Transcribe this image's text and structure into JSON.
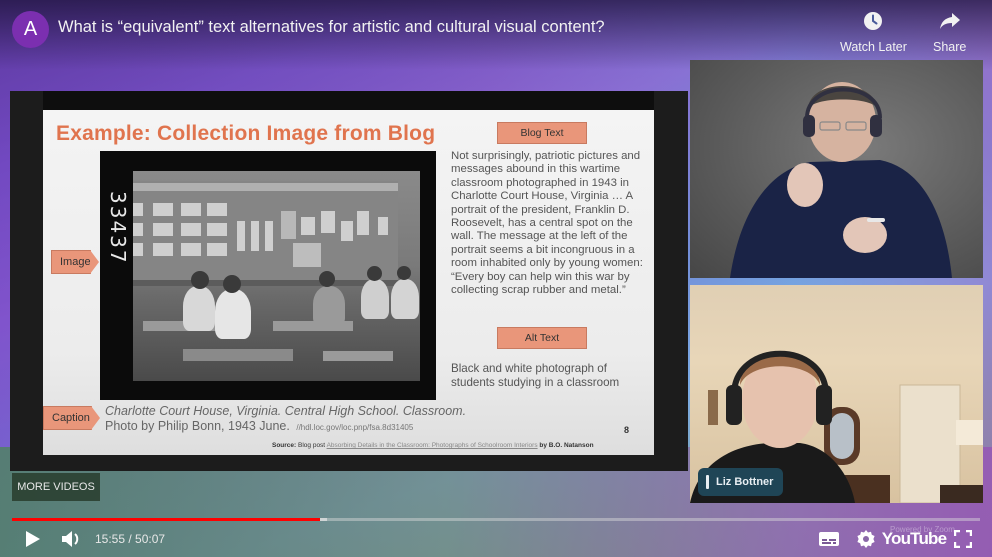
{
  "header": {
    "channel_avatar_letter": "A",
    "title": "What is “equivalent” text alternatives for artistic and cultural visual content?",
    "actions": [
      {
        "label": "Watch Later",
        "icon": "clock-icon"
      },
      {
        "label": "Share",
        "icon": "share-arrow-icon"
      }
    ]
  },
  "slide": {
    "title": "Example: Collection Image from Blog",
    "photo_negative_number": "33437",
    "image_tag": "Image",
    "caption_tag": "Caption",
    "caption_line1": "Charlotte Court House, Virginia. Central High School. Classroom.",
    "caption_line2": "Photo by Philip Bonn, 1943 June.",
    "caption_url": "//hdl.loc.gov/loc.pnp/fsa.8d31405",
    "blog_text_label": "Blog Text",
    "blog_text": "Not surprisingly, patriotic pictures and messages abound in this wartime classroom photographed in 1943 in Charlotte Court House, Virginia … A portrait of the president, Franklin D. Roosevelt, has a central spot on the wall. The message at the left of the portrait seems a bit incongruous in a room inhabited only by young women: “Every boy can help win this war by collecting scrap rubber and metal.”",
    "alt_text_label": "Alt Text",
    "alt_text": "Black and white photograph of students studying in a classroom",
    "slide_number": "8",
    "source_prefix": "Source:",
    "source_text": "Blog post",
    "source_link": "Absorbing Details in the Classroom: Photographs of Schoolroom Interiors",
    "source_author": "by B.O. Natanson"
  },
  "participants": [
    {
      "name": ""
    },
    {
      "name": "Liz Bottner"
    }
  ],
  "controls": {
    "more_videos": "MORE VIDEOS",
    "current_time": "15:55",
    "duration": "50:07",
    "time_display": "15:55 / 50:07",
    "progress_played_fraction": 0.318,
    "progress_loaded_fraction": 0.325,
    "powered_by": "Powered by Zoom",
    "youtube_logo": "YouTube",
    "progress_color": "#ff0000"
  }
}
